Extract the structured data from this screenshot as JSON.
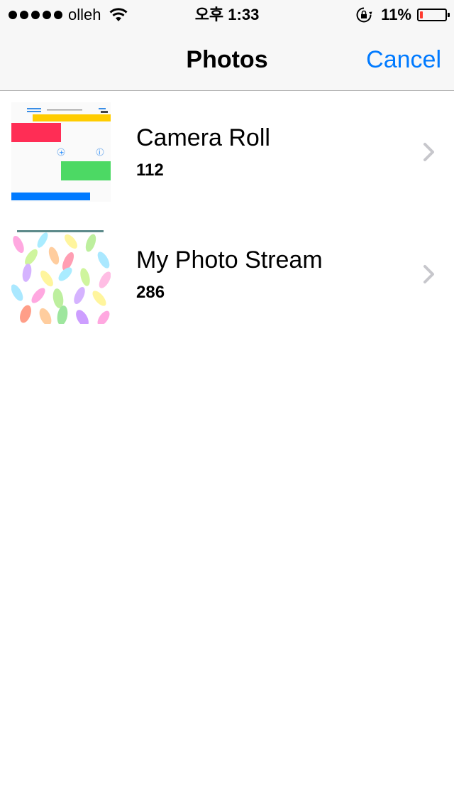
{
  "status_bar": {
    "carrier": "olleh",
    "time": "오후 1:33",
    "battery_percent": "11%",
    "battery_level": 0.11,
    "battery_color": "#ff3b30",
    "icons": [
      "signal-dots",
      "wifi-icon",
      "rotation-lock-icon",
      "battery-icon"
    ]
  },
  "nav": {
    "title": "Photos",
    "cancel_label": "Cancel",
    "accent_color": "#007aff"
  },
  "albums": [
    {
      "title": "Camera Roll",
      "count": "112",
      "thumbnail": "app-screenshot"
    },
    {
      "title": "My Photo Stream",
      "count": "286",
      "thumbnail": "colorful-petals-wallpaper"
    }
  ]
}
